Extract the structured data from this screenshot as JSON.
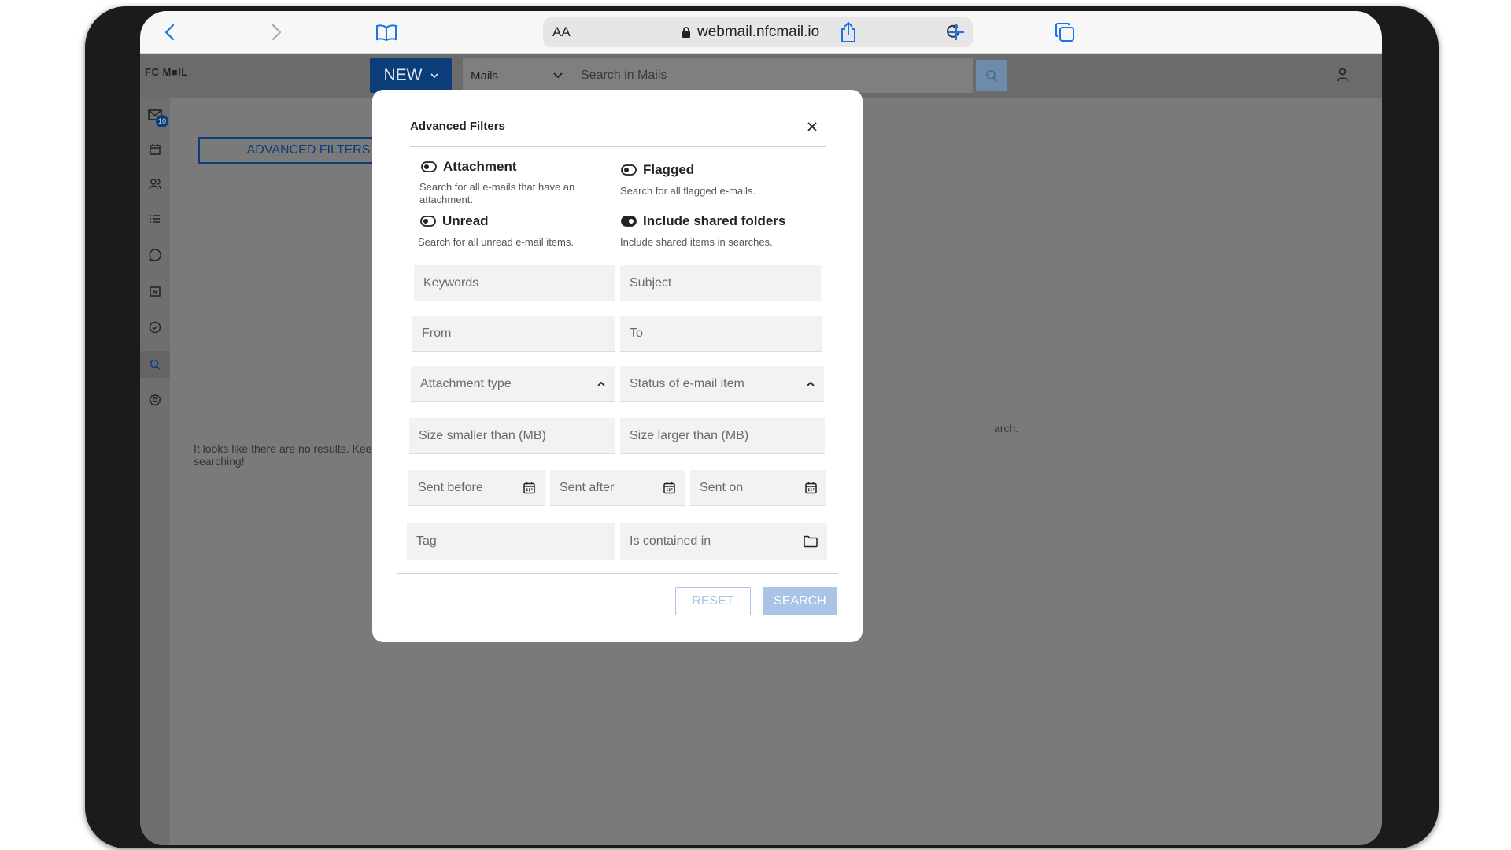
{
  "browser": {
    "aa_label": "AA",
    "url": "webmail.nfcmail.io"
  },
  "app": {
    "logo_text": "FC M■IL",
    "new_button_label": "NEW",
    "scope_select_value": "Mails",
    "search_placeholder": "Search in Mails",
    "unread_badge": "10"
  },
  "left_panel": {
    "advanced_filters_label": "ADVANCED FILTERS",
    "no_results_text": "It looks like there are no results. Keep searching!"
  },
  "background": {
    "partial_text": "arch."
  },
  "modal": {
    "title": "Advanced Filters",
    "toggles": [
      {
        "label": "Attachment",
        "description": "Search for all e-mails that have an attachment.",
        "on": false
      },
      {
        "label": "Flagged",
        "description": "Search for all flagged e-mails.",
        "on": false
      },
      {
        "label": "Unread",
        "description": "Search for all unread e-mail items.",
        "on": false
      },
      {
        "label": "Include shared folders",
        "description": "Include shared items in searches.",
        "on": true
      }
    ],
    "fields": {
      "keywords": "Keywords",
      "subject": "Subject",
      "from": "From",
      "to": "To",
      "attachment_type": "Attachment type",
      "status": "Status of e-mail item",
      "size_smaller": "Size smaller than (MB)",
      "size_larger": "Size larger than (MB)",
      "sent_before": "Sent before",
      "sent_after": "Sent after",
      "sent_on": "Sent on",
      "tag": "Tag",
      "contained_in": "Is contained in"
    },
    "reset_label": "RESET",
    "search_label": "SEARCH"
  },
  "colors": {
    "brand": "#0b3d79",
    "button_disabled": "#a9c4e6",
    "overlay": "#7a7a7a"
  }
}
